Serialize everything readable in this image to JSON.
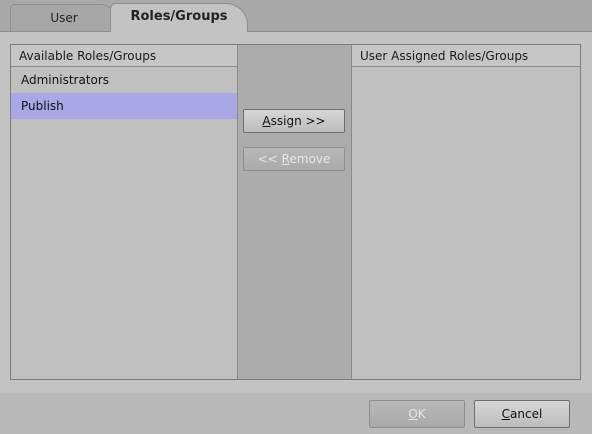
{
  "tabs": [
    {
      "label": "User",
      "active": false
    },
    {
      "label": "Roles/Groups",
      "active": true
    }
  ],
  "available": {
    "header": "Available Roles/Groups",
    "items": [
      {
        "label": "Administrators",
        "selected": false
      },
      {
        "label": "Publish",
        "selected": true
      }
    ]
  },
  "assigned": {
    "header": "User Assigned Roles/Groups",
    "items": []
  },
  "buttons": {
    "assign": {
      "mnemonic": "A",
      "rest": "ssign >>",
      "enabled": true
    },
    "remove": {
      "prefix": "<< ",
      "mnemonic": "R",
      "rest": "emove",
      "enabled": false
    },
    "ok": {
      "mnemonic": "O",
      "rest": "K",
      "enabled": false
    },
    "cancel": {
      "mnemonic": "C",
      "rest": "ancel",
      "enabled": true
    }
  },
  "colors": {
    "selection": "#a9a7e6",
    "panel": "#c3c3c3"
  }
}
